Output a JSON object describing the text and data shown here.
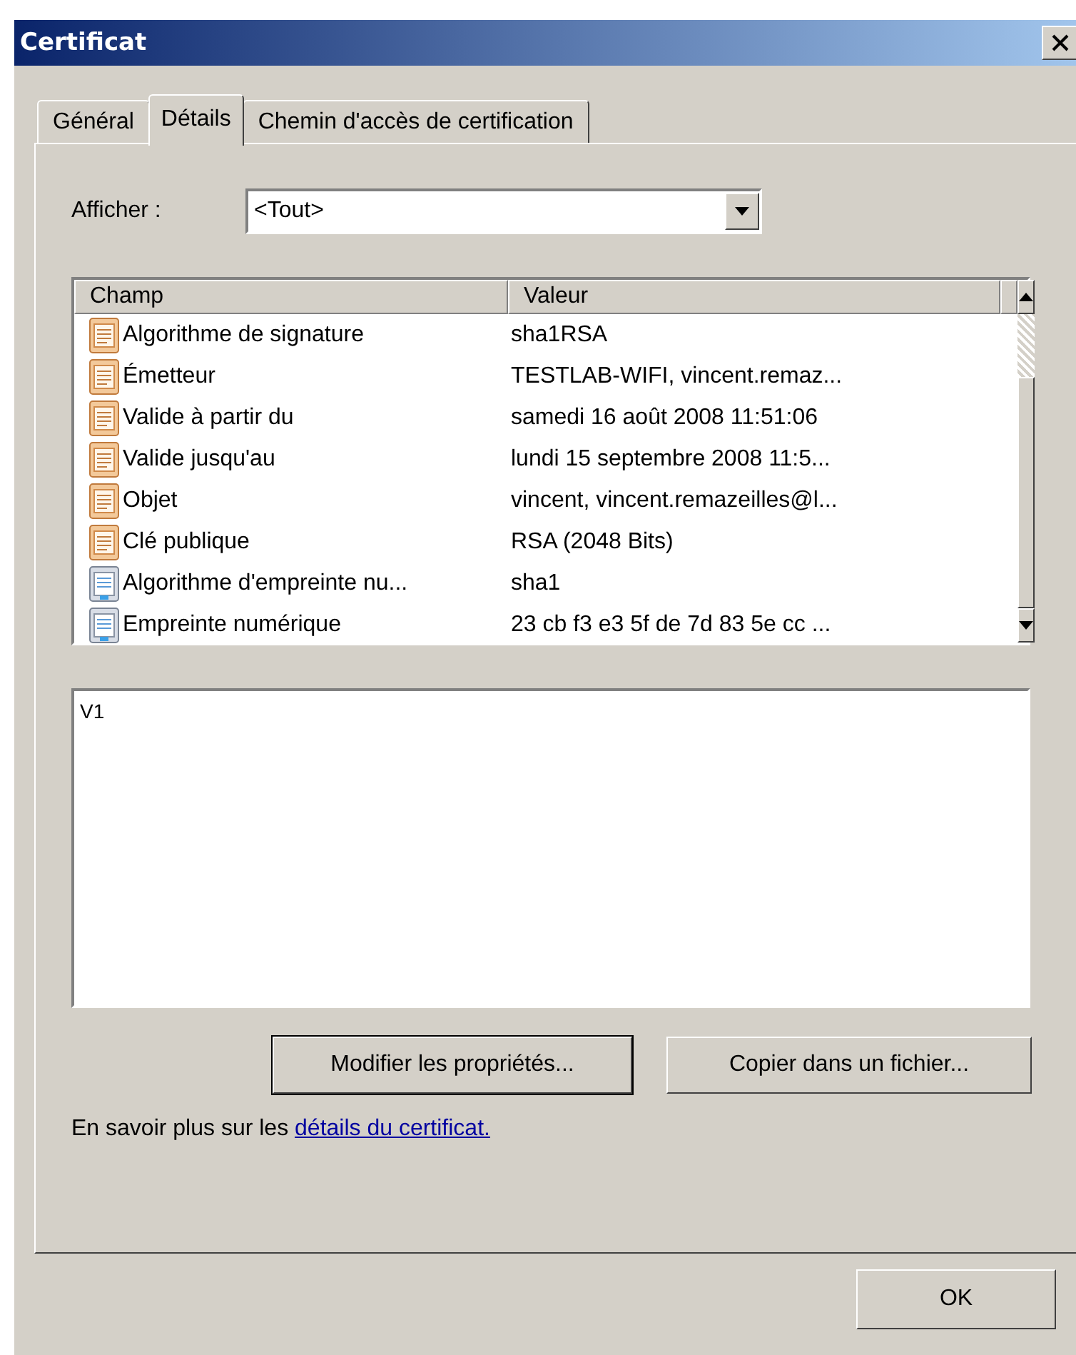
{
  "window": {
    "title": "Certificat"
  },
  "tabs": [
    {
      "label": "Général",
      "selected": false
    },
    {
      "label": "Détails",
      "selected": true
    },
    {
      "label": "Chemin d'accès de certification",
      "selected": false
    }
  ],
  "show": {
    "label": "Afficher :",
    "value": "<Tout>"
  },
  "table": {
    "columns": [
      "Champ",
      "Valeur"
    ],
    "rows": [
      {
        "kind": "field",
        "field": "Algorithme de signature",
        "value": "sha1RSA"
      },
      {
        "kind": "field",
        "field": "Émetteur",
        "value": "TESTLAB-WIFI, vincent.remaz..."
      },
      {
        "kind": "field",
        "field": "Valide à partir du",
        "value": "samedi 16 août 2008 11:51:06"
      },
      {
        "kind": "field",
        "field": "Valide jusqu'au",
        "value": "lundi 15 septembre 2008 11:5..."
      },
      {
        "kind": "field",
        "field": "Objet",
        "value": "vincent, vincent.remazeilles@l..."
      },
      {
        "kind": "field",
        "field": "Clé publique",
        "value": "RSA (2048 Bits)"
      },
      {
        "kind": "property",
        "field": "Algorithme d'empreinte nu...",
        "value": "sha1"
      },
      {
        "kind": "property",
        "field": "Empreinte numérique",
        "value": "23 cb f3 e3 5f de 7d 83 5e cc ..."
      }
    ]
  },
  "detail": {
    "value": "V1"
  },
  "buttons": [
    "Modifier les propriétés...",
    "Copier dans un fichier..."
  ],
  "learn_more": {
    "text": "En savoir plus sur les",
    "link": "détails du certificat."
  },
  "ok_button": "OK"
}
